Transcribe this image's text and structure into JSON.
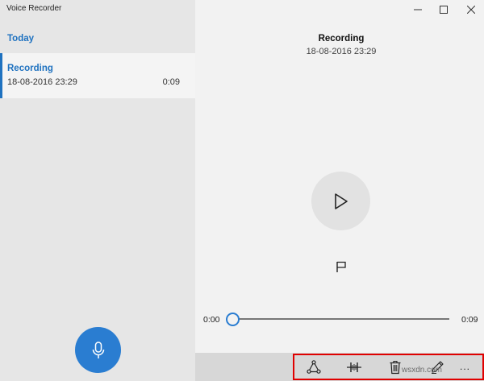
{
  "app": {
    "title": "Voice Recorder"
  },
  "sidebar": {
    "group_header": "Today",
    "recordings": [
      {
        "title": "Recording",
        "date": "18-08-2016 23:29",
        "duration": "0:09"
      }
    ]
  },
  "main": {
    "title": "Recording",
    "date": "18-08-2016 23:29"
  },
  "playback": {
    "current_time": "0:00",
    "total_time": "0:09",
    "progress": 0
  },
  "icons": {
    "record": "microphone-icon",
    "play": "play-icon",
    "marker": "flag-icon",
    "share": "share-icon",
    "trim": "trim-icon",
    "delete": "trash-icon",
    "rename": "pencil-icon",
    "more": "more-icon"
  },
  "command_bar": {
    "more_label": "..."
  },
  "watermark": "wsxdn.com",
  "colors": {
    "accent": "#2a7dd1",
    "link_blue": "#1f72c0",
    "highlight_box": "#e00000"
  }
}
